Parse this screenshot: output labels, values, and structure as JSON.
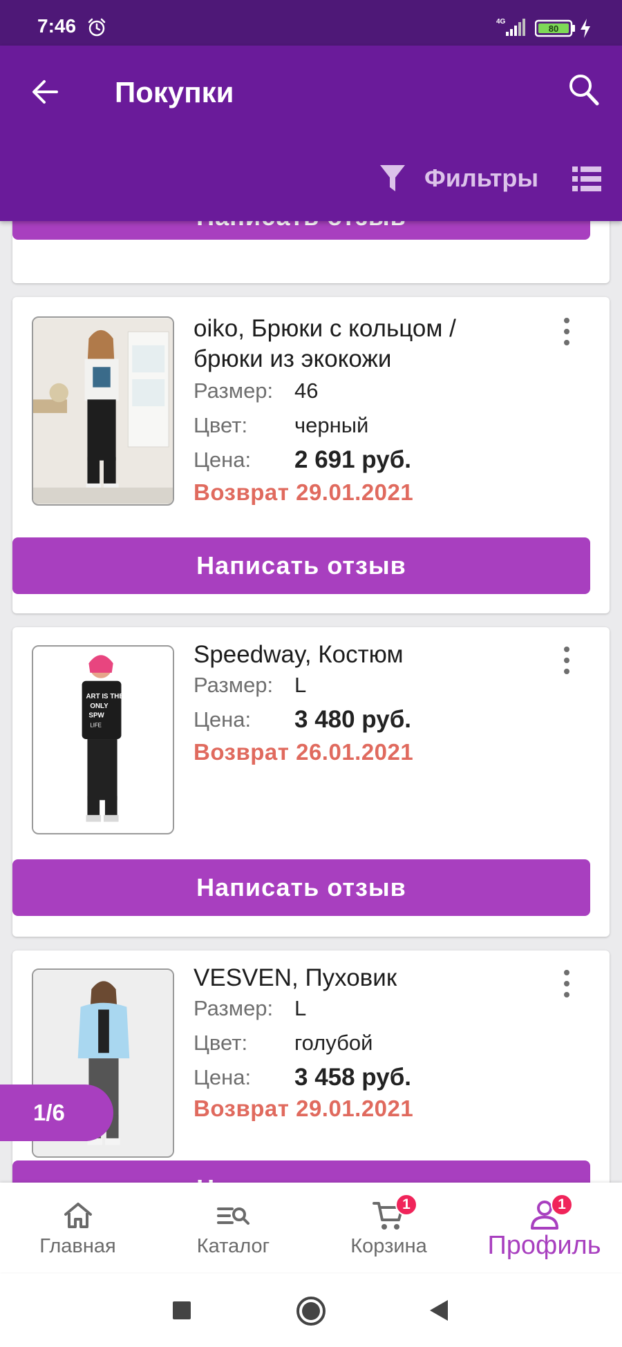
{
  "status_bar": {
    "time": "7:46",
    "network": "4G",
    "battery": "80"
  },
  "app_bar": {
    "title": "Покупки",
    "filters_label": "Фильтры"
  },
  "review_label": "Написать отзыв",
  "labels": {
    "size": "Размер:",
    "color": "Цвет:",
    "price": "Цена:"
  },
  "products": [
    {
      "title": "oiko, Брюки с кольцом / брюки из экокожи",
      "size": "46",
      "color": "черный",
      "price": "2 691 руб.",
      "return": "Возврат 29.01.2021"
    },
    {
      "title": "Speedway, Костюм",
      "size": "L",
      "price": "3 480 руб.",
      "return": "Возврат 26.01.2021"
    },
    {
      "title": "VESVEN, Пуховик",
      "size": "L",
      "color": "голубой",
      "price": "3 458 руб.",
      "return": "Возврат 29.01.2021"
    }
  ],
  "page_indicator": "1/6",
  "bottom_nav": [
    {
      "label": "Главная",
      "icon": "home-icon"
    },
    {
      "label": "Каталог",
      "icon": "catalog-icon"
    },
    {
      "label": "Корзина",
      "icon": "cart-icon",
      "badge": "1"
    },
    {
      "label": "Профиль",
      "icon": "profile-icon",
      "badge": "1",
      "active": true
    }
  ],
  "colors": {
    "status_bar": "#4e1877",
    "app_bar": "#6a1b9a",
    "accent": "#a83fbf",
    "return_text": "#e06a5e",
    "badge": "#f0245a"
  }
}
